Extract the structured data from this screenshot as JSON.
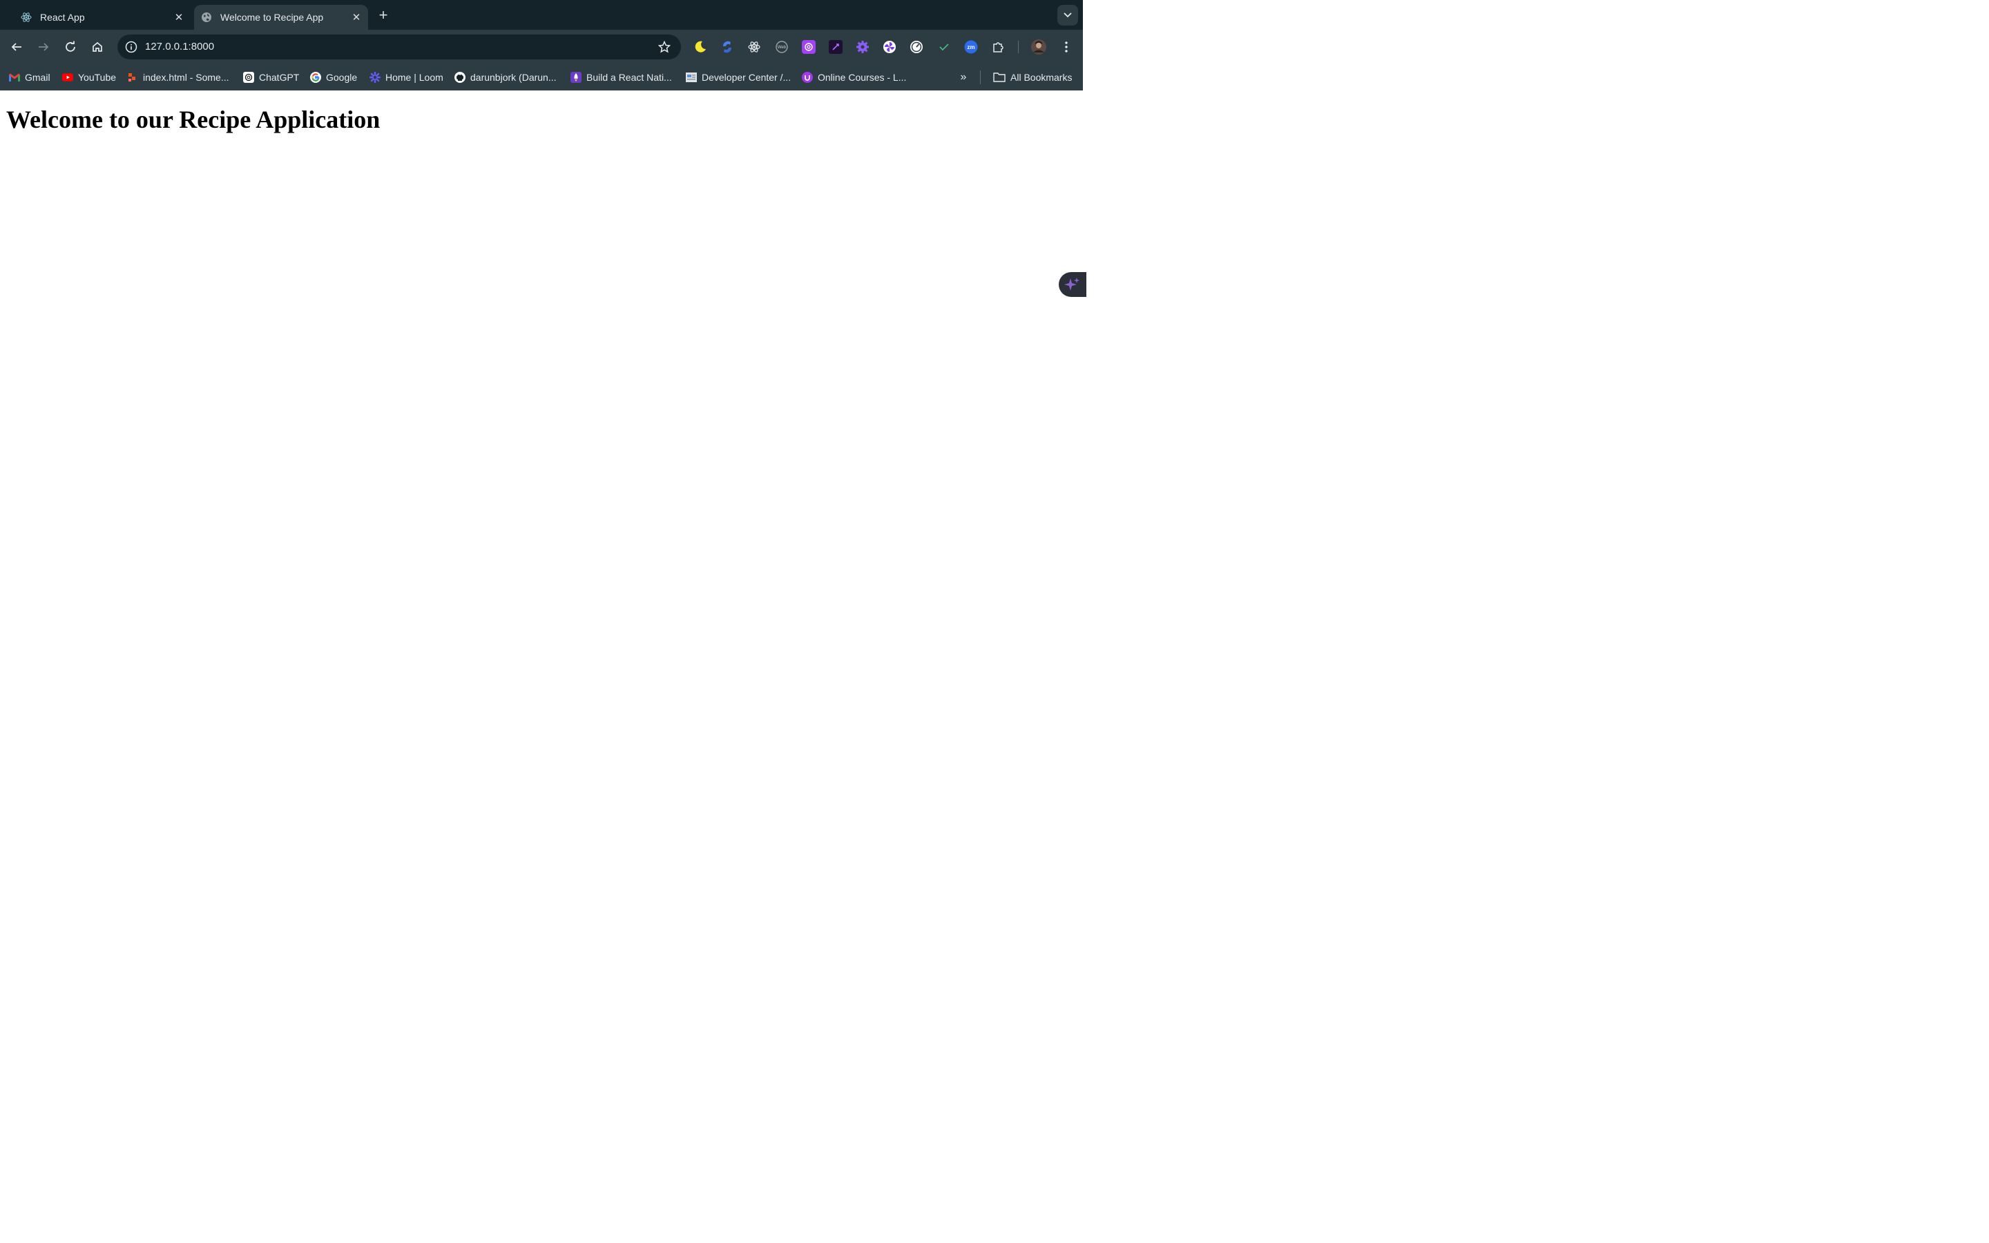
{
  "tabs": [
    {
      "title": "React App",
      "active": false,
      "icon": "react-icon"
    },
    {
      "title": "Welcome to Recipe App",
      "active": true,
      "icon": "globe-icon"
    }
  ],
  "toolbar": {
    "url": "127.0.0.1:8000"
  },
  "extensions": [
    "dark-mode-moon-icon",
    "blue-swirl-icon",
    "react-devtools-icon",
    "web-icon",
    "openai-icon",
    "dark-extension-icon",
    "gear-extension-icon",
    "pinwheel-icon",
    "speedometer-icon",
    "vue-check-icon",
    "zoom-icon",
    "puzzle-icon",
    "profile-avatar"
  ],
  "bookmarks": [
    {
      "label": "Gmail",
      "icon": "gmail-icon"
    },
    {
      "label": "YouTube",
      "icon": "youtube-icon"
    },
    {
      "label": "index.html - Some...",
      "icon": "figma-icon"
    },
    {
      "label": "ChatGPT",
      "icon": "chatgpt-icon"
    },
    {
      "label": "Google",
      "icon": "google-icon"
    },
    {
      "label": "Home | Loom",
      "icon": "loom-icon"
    },
    {
      "label": "darunbjork (Darun...",
      "icon": "github-icon"
    },
    {
      "label": "Build a React Nati...",
      "icon": "rocket-icon"
    },
    {
      "label": "Developer Center /...",
      "icon": "developer-center-icon"
    },
    {
      "label": "Online Courses - L...",
      "icon": "udemy-icon"
    }
  ],
  "all_bookmarks_label": "All Bookmarks",
  "page": {
    "heading": "Welcome to our Recipe Application"
  }
}
